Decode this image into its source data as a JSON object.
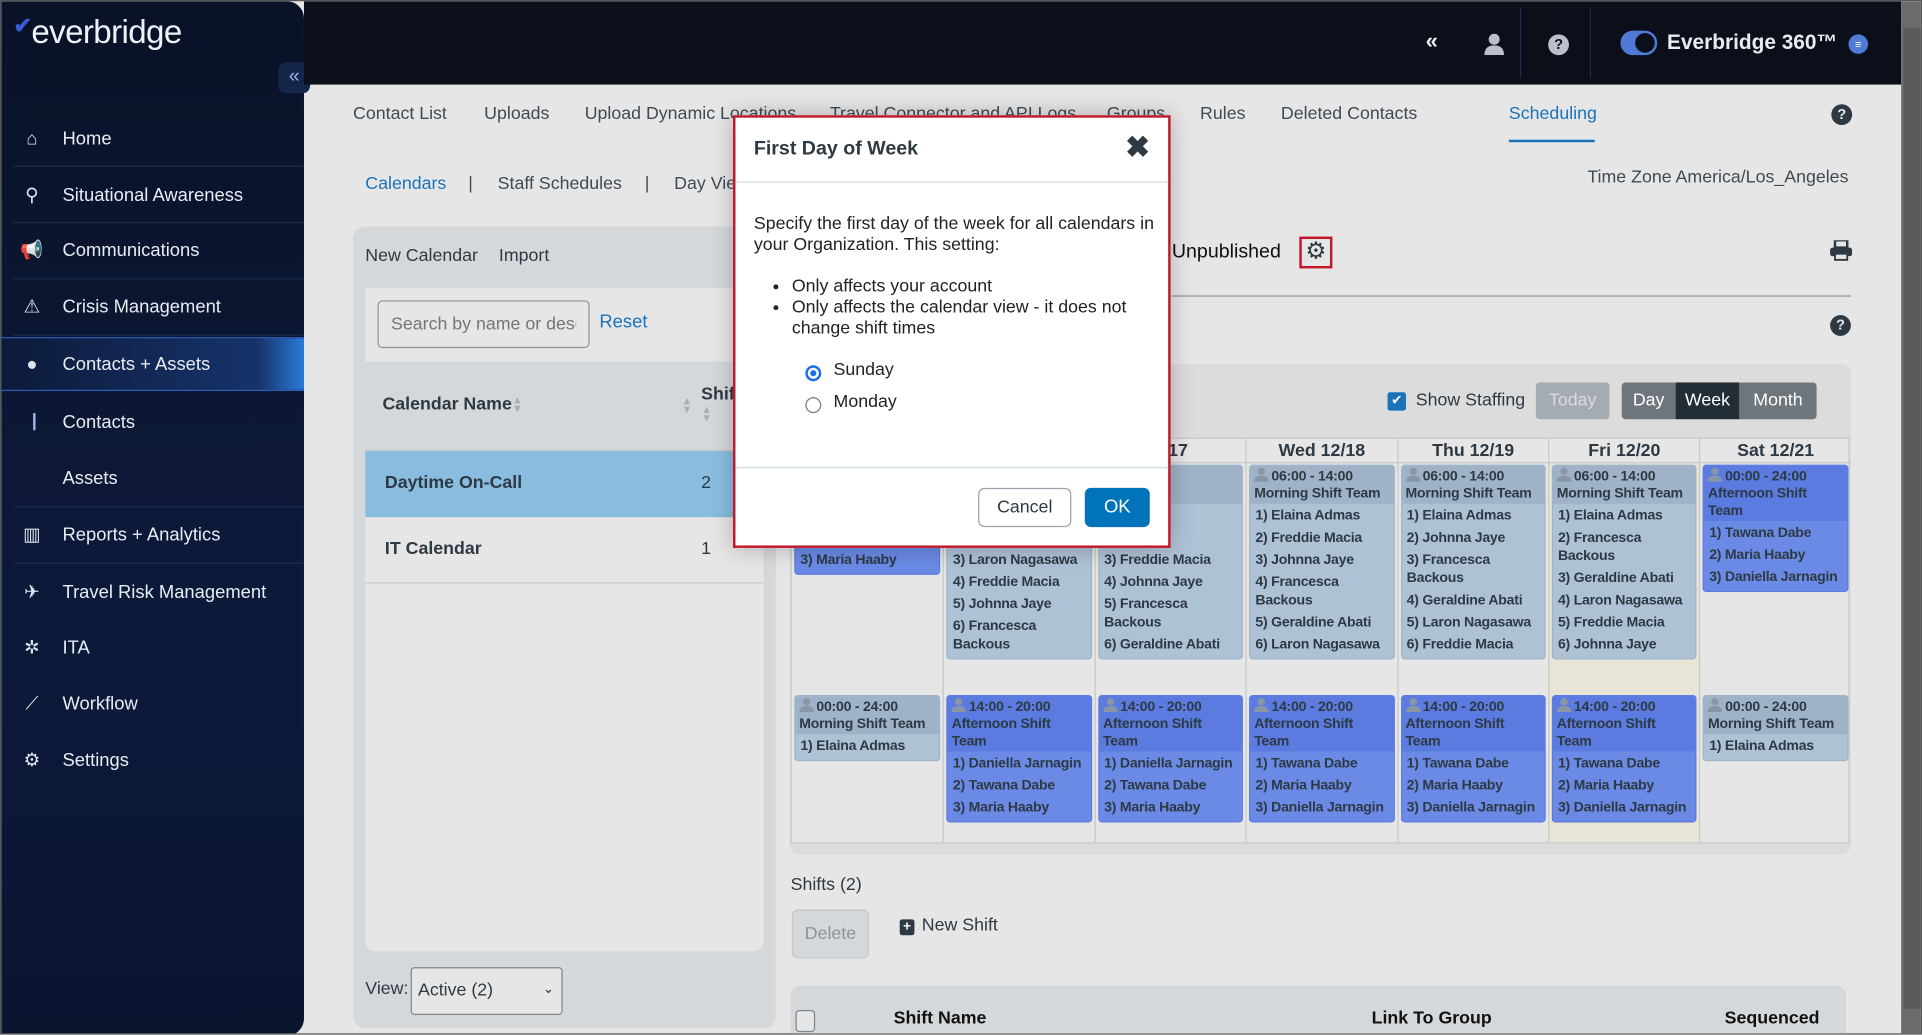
{
  "sidebar": {
    "logo": "everbridge",
    "collapse_icon": "«",
    "items": [
      {
        "label": "Home",
        "icon": "home-icon",
        "glyph": "⌂"
      },
      {
        "label": "Situational Awareness",
        "icon": "map-pin-icon",
        "glyph": "⚲"
      },
      {
        "label": "Communications",
        "icon": "megaphone-icon",
        "glyph": "📢"
      },
      {
        "label": "Crisis Management",
        "icon": "crisis-icon",
        "glyph": "⚠"
      },
      {
        "label": "Contacts + Assets",
        "icon": "location-pin-icon",
        "glyph": "●"
      },
      {
        "label": "Contacts"
      },
      {
        "label": "Assets"
      },
      {
        "label": "Reports + Analytics",
        "icon": "reports-icon",
        "glyph": "▥"
      },
      {
        "label": "Travel Risk Management",
        "icon": "plane-icon",
        "glyph": "✈"
      },
      {
        "label": "ITA",
        "icon": "ita-icon",
        "glyph": "✲"
      },
      {
        "label": "Workflow",
        "icon": "chart-line-icon",
        "glyph": "⟋"
      },
      {
        "label": "Settings",
        "icon": "gear-icon",
        "glyph": "⚙"
      }
    ]
  },
  "topbar": {
    "collapse": "«",
    "product": "Everbridge 360™",
    "toggle_on": true
  },
  "tabs": [
    "Contact List",
    "Uploads",
    "Upload Dynamic Locations",
    "Travel Connector and API Logs",
    "Groups",
    "Rules",
    "Deleted Contacts",
    "Scheduling"
  ],
  "active_tab": "Scheduling",
  "subnav": {
    "calendars": "Calendars",
    "staff": "Staff Schedules",
    "day": "Day Vie",
    "sep": "|"
  },
  "timezone": "Time Zone America/Los_Angeles",
  "left": {
    "new_calendar": "New Calendar",
    "import": "Import",
    "search_placeholder": "Search by name or desc",
    "reset": "Reset",
    "col_name": "Calendar Name",
    "col_shifts": "Shif",
    "rows": [
      {
        "name": "Daytime On-Call",
        "shifts": "2"
      },
      {
        "name": "IT Calendar",
        "shifts": "1"
      }
    ],
    "view_label": "View:",
    "view_value": "Active (2)"
  },
  "status": "Unpublished",
  "toolbar": {
    "show_staffing": "Show Staffing",
    "show_staffing_checked": true,
    "today": "Today",
    "day": "Day",
    "week": "Week",
    "month": "Month",
    "active_view": "Week"
  },
  "calendar": {
    "days": [
      "",
      "",
      "2/17",
      "Wed 12/18",
      "Thu 12/19",
      "Fri 12/20",
      "Sat 12/21"
    ],
    "today_index": 5,
    "row1": [
      {
        "style": "blue",
        "time": "",
        "team": "",
        "items": [
          "",
          "",
          "3) Maria Haaby"
        ]
      },
      {
        "style": "gray",
        "time": "",
        "team": "",
        "items": [
          "",
          "",
          "3) Laron Nagasawa",
          "4) Freddie Macia",
          "5) Johnna Jaye",
          "6) Francesca Backous"
        ]
      },
      {
        "style": "gray",
        "time": "",
        "team": "",
        "items": [
          "",
          "",
          "3) Freddie Macia",
          "4) Johnna Jaye",
          "5) Francesca Backous",
          "6) Geraldine Abati"
        ]
      },
      {
        "style": "gray",
        "time": "06:00 - 14:00",
        "team": "Morning Shift Team",
        "items": [
          "1) Elaina Admas",
          "2) Freddie Macia",
          "3) Johnna Jaye",
          "4) Francesca Backous",
          "5) Geraldine Abati",
          "6) Laron Nagasawa"
        ]
      },
      {
        "style": "gray",
        "time": "06:00 - 14:00",
        "team": "Morning Shift Team",
        "items": [
          "1) Elaina Admas",
          "2) Johnna Jaye",
          "3) Francesca Backous",
          "4) Geraldine Abati",
          "5) Laron Nagasawa",
          "6) Freddie Macia"
        ]
      },
      {
        "style": "gray",
        "time": "06:00 - 14:00",
        "team": "Morning Shift Team",
        "items": [
          "1) Elaina Admas",
          "2) Francesca Backous",
          "3) Geraldine Abati",
          "4) Laron Nagasawa",
          "5) Freddie Macia",
          "6) Johnna Jaye"
        ]
      },
      {
        "style": "blue",
        "time": "00:00 - 24:00",
        "team": "Afternoon Shift Team",
        "items": [
          "1) Tawana Dabe",
          "2) Maria Haaby",
          "3) Daniella Jarnagin"
        ]
      }
    ],
    "row2": [
      {
        "style": "gray",
        "time": "00:00 - 24:00",
        "team": "Morning Shift Team",
        "items": [
          "1) Elaina Admas"
        ]
      },
      {
        "style": "blue",
        "time": "14:00 - 20:00",
        "team": "Afternoon Shift Team",
        "items": [
          "1) Daniella Jarnagin",
          "2) Tawana Dabe",
          "3) Maria Haaby"
        ]
      },
      {
        "style": "blue",
        "time": "14:00 - 20:00",
        "team": "Afternoon Shift Team",
        "items": [
          "1) Daniella Jarnagin",
          "2) Tawana Dabe",
          "3) Maria Haaby"
        ]
      },
      {
        "style": "blue",
        "time": "14:00 - 20:00",
        "team": "Afternoon Shift Team",
        "items": [
          "1) Tawana Dabe",
          "2) Maria Haaby",
          "3) Daniella Jarnagin"
        ]
      },
      {
        "style": "blue",
        "time": "14:00 - 20:00",
        "team": "Afternoon Shift Team",
        "items": [
          "1) Tawana Dabe",
          "2) Maria Haaby",
          "3) Daniella Jarnagin"
        ]
      },
      {
        "style": "blue",
        "time": "14:00 - 20:00",
        "team": "Afternoon Shift Team",
        "items": [
          "1) Tawana Dabe",
          "2) Maria Haaby",
          "3) Daniella Jarnagin"
        ]
      },
      {
        "style": "gray",
        "time": "00:00 - 24:00",
        "team": "Morning Shift Team",
        "items": [
          "1) Elaina Admas"
        ]
      }
    ]
  },
  "shifts": {
    "title": "Shifts (2)",
    "delete": "Delete",
    "new_shift": "New Shift",
    "col_name": "Shift Name",
    "col_group": "Link To Group",
    "col_seq": "Sequenced"
  },
  "dialog": {
    "title": "First Day of Week",
    "text": "Specify the first day of the week for all calendars in your Organization. This setting:",
    "bullets": [
      "Only affects your account",
      "Only affects the calendar view - it does not change shift times"
    ],
    "options": [
      "Sunday",
      "Monday"
    ],
    "selected": "Sunday",
    "cancel": "Cancel",
    "ok": "OK"
  },
  "colors": {
    "accent": "#1a73b8",
    "ok": "#0073bb",
    "highlight_border": "#c0182a",
    "selected_row": "#89bde0",
    "blue_shift": "#6a8ae6",
    "gray_shift": "#aec2d6",
    "today": "#e8e5d6"
  }
}
